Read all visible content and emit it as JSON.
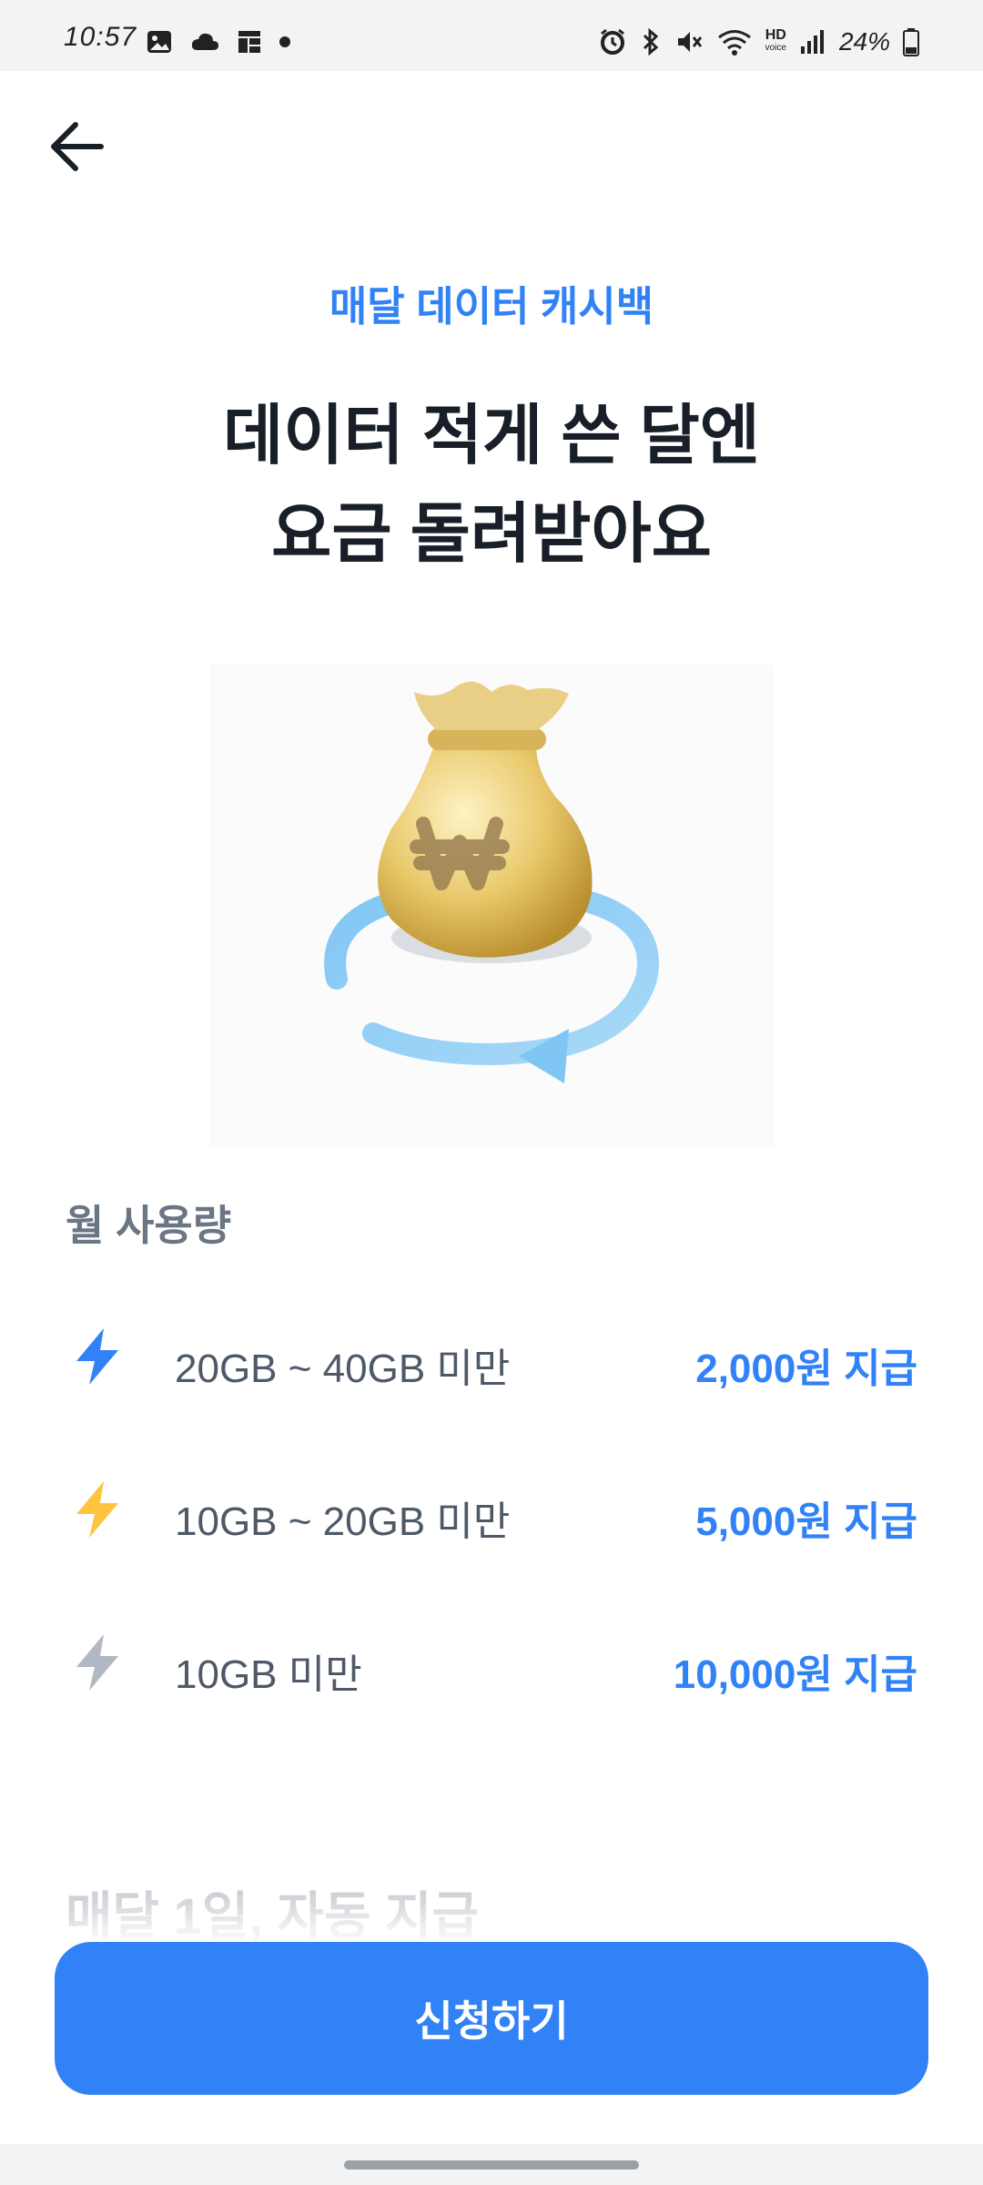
{
  "status_bar": {
    "time": "10:57",
    "battery": "24%",
    "hd_label": "HD",
    "hd_sub": "voice",
    "icons": [
      "gallery-icon",
      "cloud-icon",
      "grid-icon",
      "dot-icon",
      "alarm-icon",
      "bluetooth-icon",
      "mute-icon",
      "wifi-icon",
      "hd-voice-icon",
      "signal-icon",
      "battery-icon"
    ]
  },
  "header": {
    "back_icon": "arrow-left-icon"
  },
  "hero": {
    "eyebrow": "매달 데이터 캐시백",
    "headline_line1": "데이터 적게 쓴 달엔",
    "headline_line2": "요금 돌려받아요",
    "illustration": "money-bag-cycle-illustration"
  },
  "usage": {
    "title": "월 사용량",
    "tiers": [
      {
        "range": "20GB ~ 40GB 미만",
        "amount": "2,000원 지급",
        "icon_color": "#3182f6"
      },
      {
        "range": "10GB ~ 20GB 미만",
        "amount": "5,000원 지급",
        "icon_color": "#ffc342"
      },
      {
        "range": "10GB 미만",
        "amount": "10,000원 지급",
        "icon_color": "#b0b8c1"
      }
    ]
  },
  "next_section_title": "매달 1일, 자동 지급",
  "cta": {
    "label": "신청하기"
  },
  "colors": {
    "accent": "#3182f6",
    "text_primary": "#191f28",
    "text_secondary": "#4e5968"
  }
}
